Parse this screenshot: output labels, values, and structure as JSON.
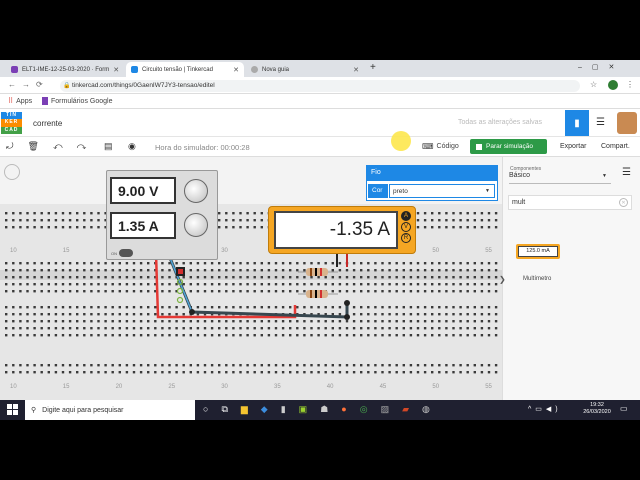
{
  "browser": {
    "tabs": [
      {
        "label": "ELT1-IME-12-25-03-2020 · Form",
        "color": "#7b3fb5",
        "active": false
      },
      {
        "label": "Circuito tensão | Tinkercad",
        "color": "#1e88e5",
        "active": true
      },
      {
        "label": "Nova guia",
        "color": "#aaaaaa",
        "active": false
      }
    ],
    "new_tab": "+",
    "url": "tinkercad.com/things/0GaenIW7JY3-tensao/editel",
    "bookmarks": [
      {
        "label": "Apps"
      },
      {
        "label": "Formulários Google"
      }
    ]
  },
  "app": {
    "logo": [
      "TIN",
      "KER",
      "CAD"
    ],
    "project_name": "corrente",
    "save_status": "Todas as alterações salvas"
  },
  "toolbar": {
    "sim_time": "Hora do simulador: 00:00:28",
    "code_label": "Código",
    "stop_label": "Parar simulação",
    "export_label": "Exportar",
    "share_label": "Compart."
  },
  "power_supply": {
    "voltage": "9.00 V",
    "current": "1.35 A",
    "on_label": "ON"
  },
  "multimeter": {
    "reading": "-1.35 A",
    "modes": [
      "A",
      "V",
      "R"
    ]
  },
  "wire_panel": {
    "title": "Fio",
    "color_label": "Cor",
    "color_value": "preto"
  },
  "components": {
    "caption": "Componentes",
    "category": "Básico",
    "search": "mult",
    "item_reading": "125.0 mA",
    "item_label": "Multímetro"
  },
  "rulers": {
    "top": [
      "10",
      "15",
      "20",
      "25",
      "30",
      "35",
      "40",
      "45",
      "50",
      "55"
    ],
    "bottom": [
      "10",
      "15",
      "20",
      "25",
      "30",
      "35",
      "40",
      "45",
      "50",
      "55"
    ]
  },
  "taskbar": {
    "search_placeholder": "Digite aqui para pesquisar",
    "time": "19:32",
    "date": "26/03/2020"
  }
}
